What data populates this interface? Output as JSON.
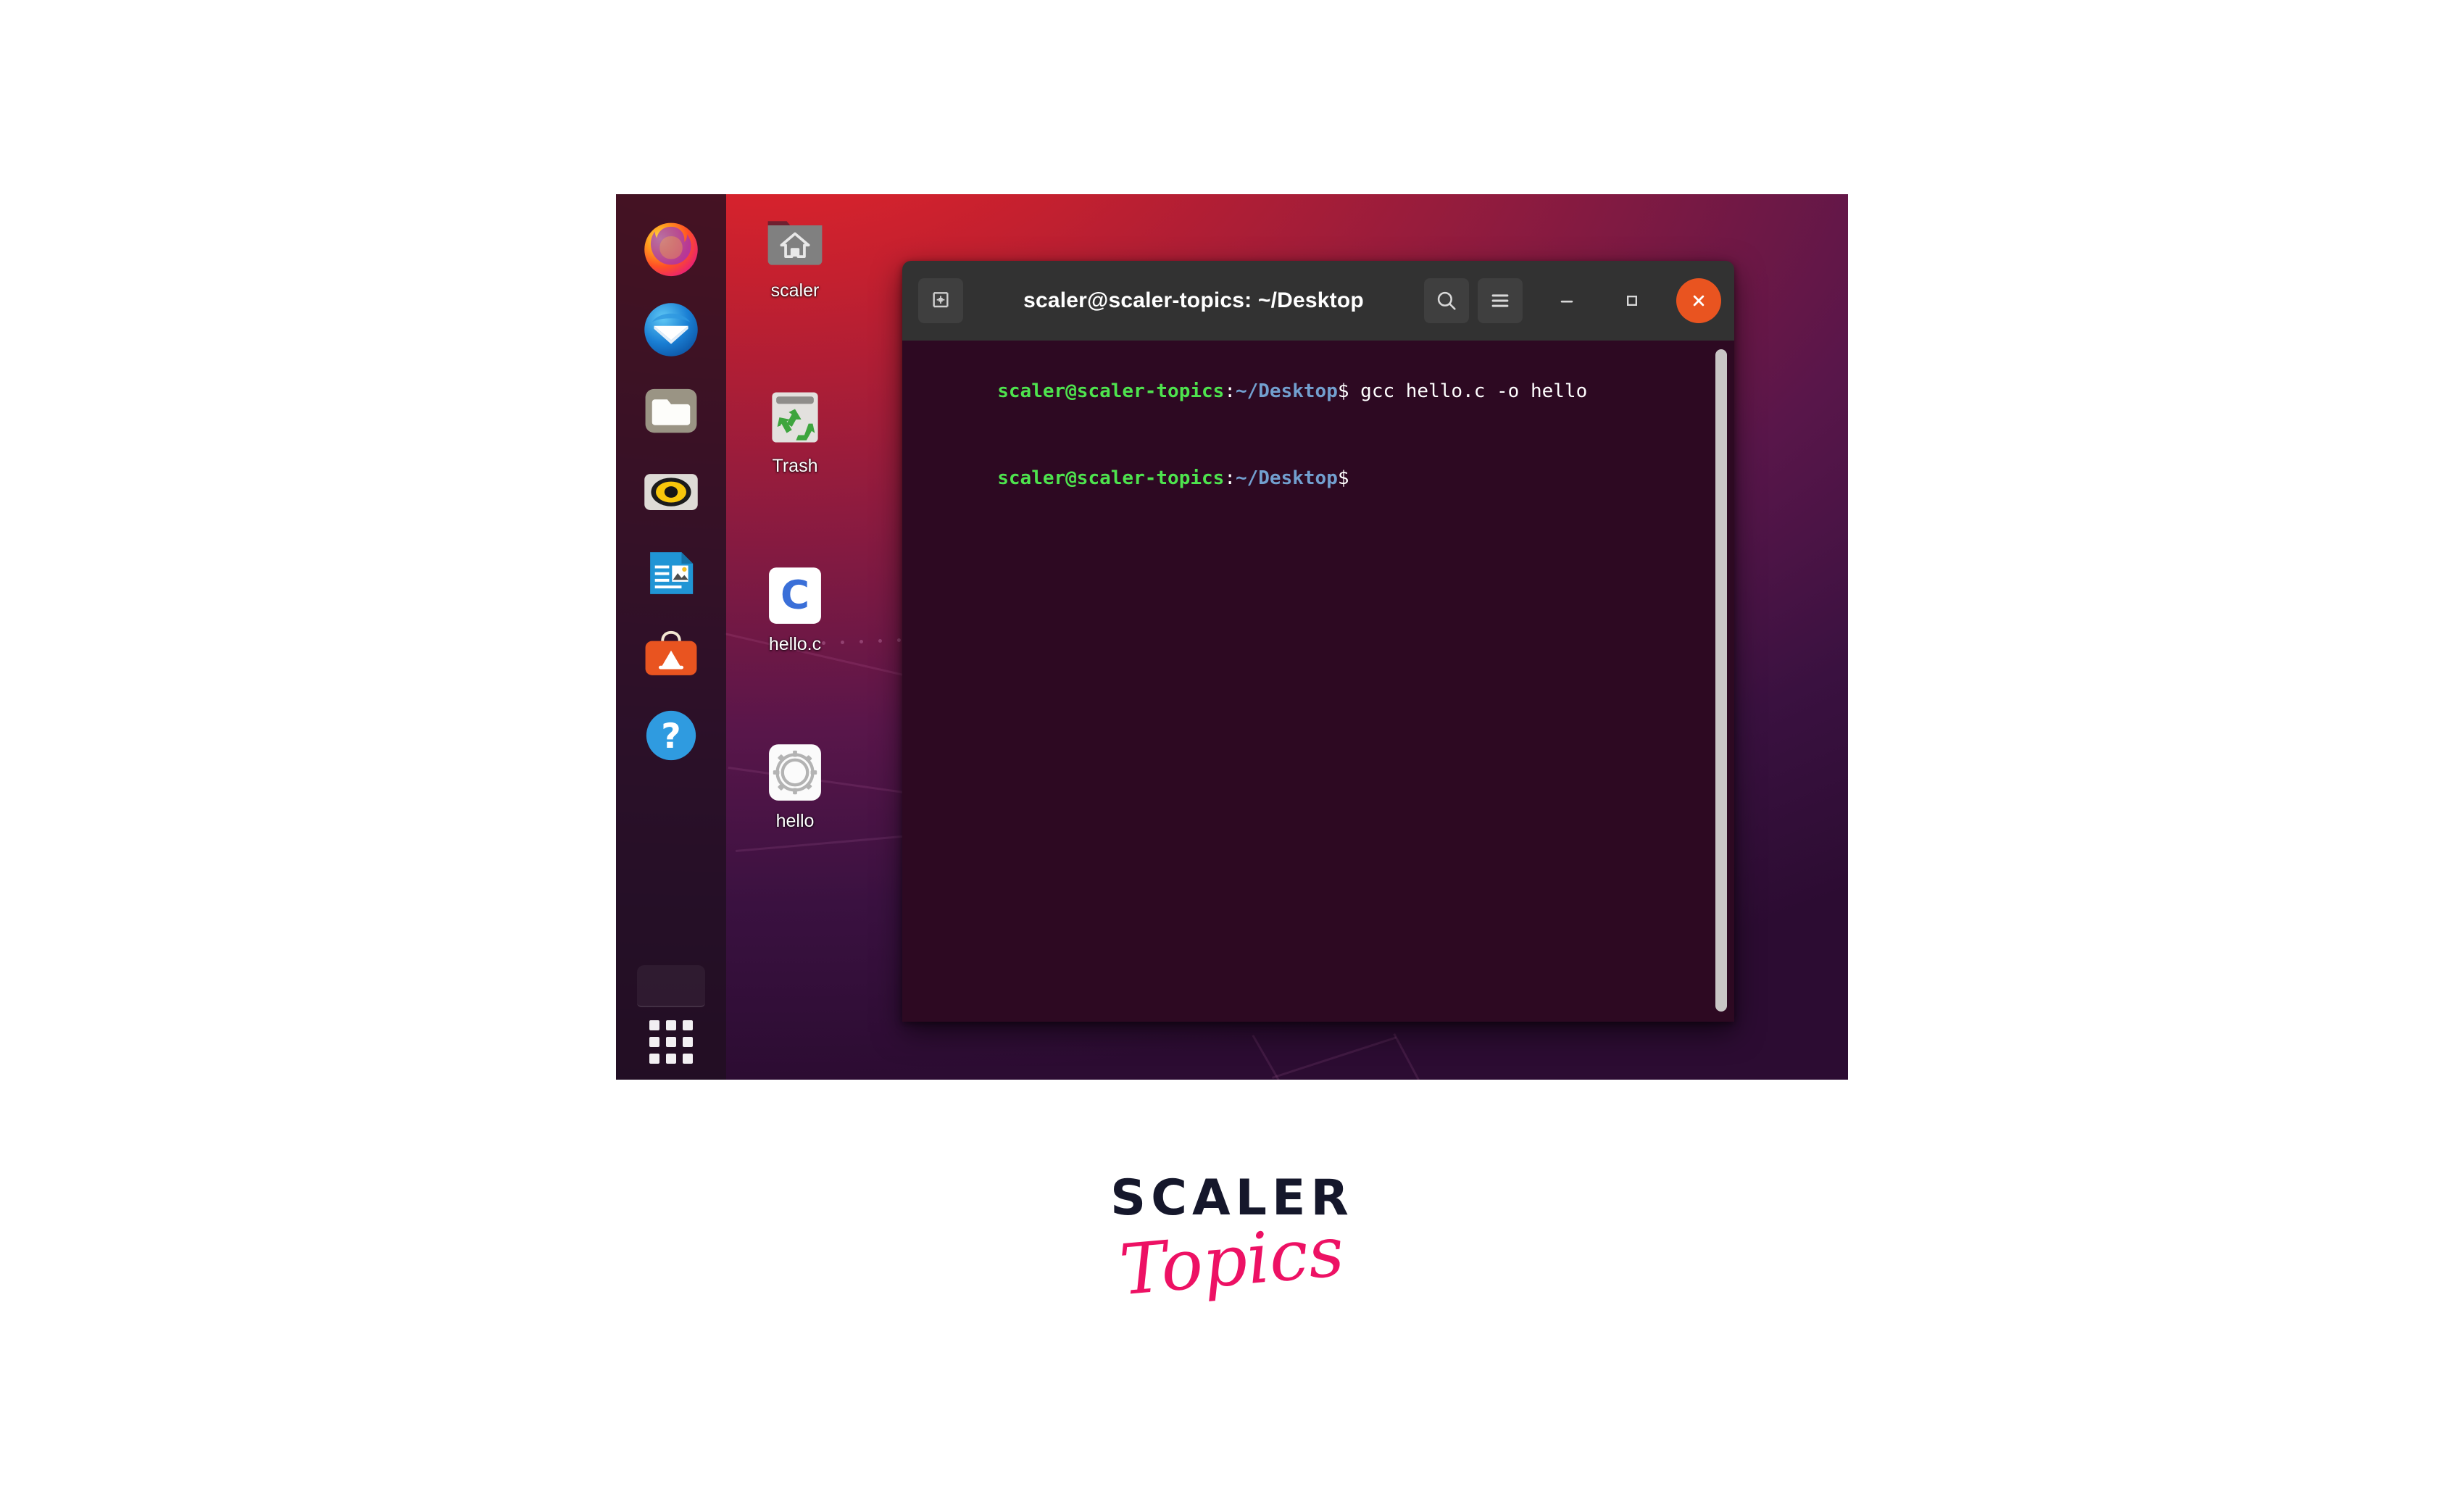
{
  "desktop": {
    "os": "Ubuntu",
    "wallpaper_colors": [
      "#e8252a",
      "#8d1b3f",
      "#2c0c32"
    ],
    "dock": {
      "items": [
        {
          "name": "firefox",
          "label": "Firefox Web Browser",
          "icon": "firefox-icon"
        },
        {
          "name": "thunderbird",
          "label": "Thunderbird Mail",
          "icon": "thunderbird-icon"
        },
        {
          "name": "files",
          "label": "Files",
          "icon": "files-folder-icon"
        },
        {
          "name": "rhythmbox",
          "label": "Rhythmbox",
          "icon": "rhythmbox-icon"
        },
        {
          "name": "libreoffice-writer",
          "label": "LibreOffice Writer",
          "icon": "writer-document-icon"
        },
        {
          "name": "ubuntu-software",
          "label": "Ubuntu Software",
          "icon": "software-bag-icon"
        },
        {
          "name": "help",
          "label": "Help",
          "icon": "help-question-icon"
        }
      ],
      "show_apps": {
        "name": "show-applications",
        "label": "Show Applications",
        "icon": "app-grid-icon"
      }
    },
    "icons": [
      {
        "name": "scaler",
        "label": "scaler",
        "type": "home-folder",
        "icon": "home-folder-icon"
      },
      {
        "name": "trash",
        "label": "Trash",
        "type": "trash",
        "icon": "trash-recycle-icon"
      },
      {
        "name": "hello-c",
        "label": "hello.c",
        "type": "c-source",
        "icon": "c-file-icon"
      },
      {
        "name": "hello",
        "label": "hello",
        "type": "executable",
        "icon": "gear-executable-icon"
      }
    ]
  },
  "terminal": {
    "title": "scaler@scaler-topics: ~/Desktop",
    "header_buttons": {
      "new_tab": "new-tab-icon",
      "search": "search-icon",
      "menu": "hamburger-menu-icon",
      "minimize": "minimize-icon",
      "maximize": "maximize-icon",
      "close": "close-icon"
    },
    "accent_close_color": "#e95420",
    "background_color": "#2d0922",
    "lines": [
      {
        "user": "scaler@scaler-topics",
        "colon": ":",
        "path": "~/Desktop",
        "dollar": "$",
        "command": " gcc hello.c -o hello"
      },
      {
        "user": "scaler@scaler-topics",
        "colon": ":",
        "path": "~/Desktop",
        "dollar": "$",
        "command": ""
      }
    ]
  },
  "brand": {
    "primary": "SCALER",
    "secondary": "Topics",
    "primary_color": "#15172b",
    "secondary_color": "#ed1164"
  }
}
